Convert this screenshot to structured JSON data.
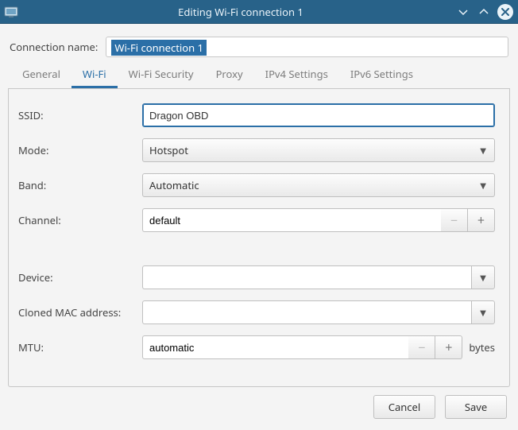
{
  "titlebar": {
    "title": "Editing Wi-Fi connection 1"
  },
  "connection_name": {
    "label": "Connection name:",
    "value": "Wi-Fi connection 1"
  },
  "tabs": {
    "general": "General",
    "wifi": "Wi-Fi",
    "wifi_security": "Wi-Fi Security",
    "proxy": "Proxy",
    "ipv4": "IPv4 Settings",
    "ipv6": "IPv6 Settings",
    "active": "wifi"
  },
  "form": {
    "ssid": {
      "label": "SSID:",
      "value": "Dragon OBD"
    },
    "mode": {
      "label": "Mode:",
      "value": "Hotspot"
    },
    "band": {
      "label": "Band:",
      "value": "Automatic"
    },
    "channel": {
      "label": "Channel:",
      "value": "default"
    },
    "device": {
      "label": "Device:",
      "value": ""
    },
    "cloned_mac": {
      "label": "Cloned MAC address:",
      "value": ""
    },
    "mtu": {
      "label": "MTU:",
      "value": "automatic",
      "unit": "bytes"
    }
  },
  "footer": {
    "cancel": "Cancel",
    "save": "Save"
  }
}
